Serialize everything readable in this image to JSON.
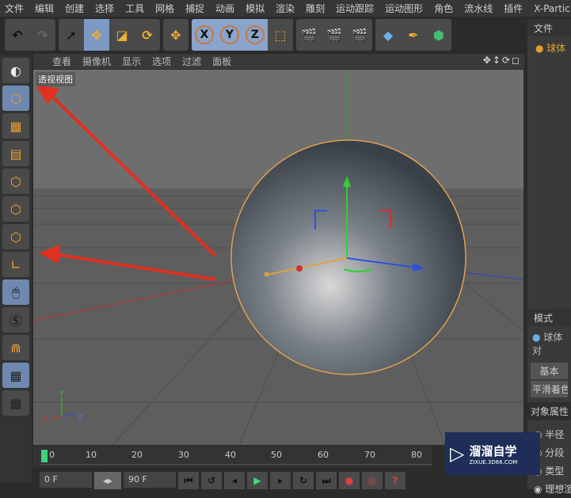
{
  "menu": [
    "文件",
    "编辑",
    "创建",
    "选择",
    "工具",
    "网格",
    "捕捉",
    "动画",
    "模拟",
    "渲染",
    "雕刻",
    "运动跟踪",
    "运动图形",
    "角色",
    "流水线",
    "插件",
    "X-Particles"
  ],
  "toolbar": {
    "axes": [
      "X",
      "Y",
      "Z"
    ]
  },
  "viewport": {
    "menu": [
      "查看",
      "摄像机",
      "显示",
      "选项",
      "过滤",
      "面板"
    ],
    "label": "透视视图",
    "nav_icons": "✥↕⟳◻",
    "axis_labels": [
      "Y",
      "X",
      "Z"
    ]
  },
  "right_panel": {
    "objects_tab": "文件",
    "object_item": "球体",
    "attr_tab": "模式",
    "attr_object": "球体对",
    "attr_tab_basic": "基本",
    "attr_smooth": "平滑着色(",
    "section": "对象属性",
    "props": [
      "半径",
      "分段",
      "类型",
      "理想渲"
    ]
  },
  "timeline": {
    "ticks": [
      "0",
      "10",
      "20",
      "30",
      "40",
      "50",
      "60",
      "70",
      "80"
    ],
    "current_frame": 0
  },
  "controls": {
    "start": "0 F",
    "end": "90 F"
  },
  "watermark": {
    "name": "溜溜自学",
    "url": "ZIXUE.3D66.COM"
  },
  "colors": {
    "accent": "#7c9ac4",
    "selection": "#e0a050",
    "x_axis": "#d03030",
    "y_axis": "#30c030",
    "z_axis": "#3050e0"
  }
}
